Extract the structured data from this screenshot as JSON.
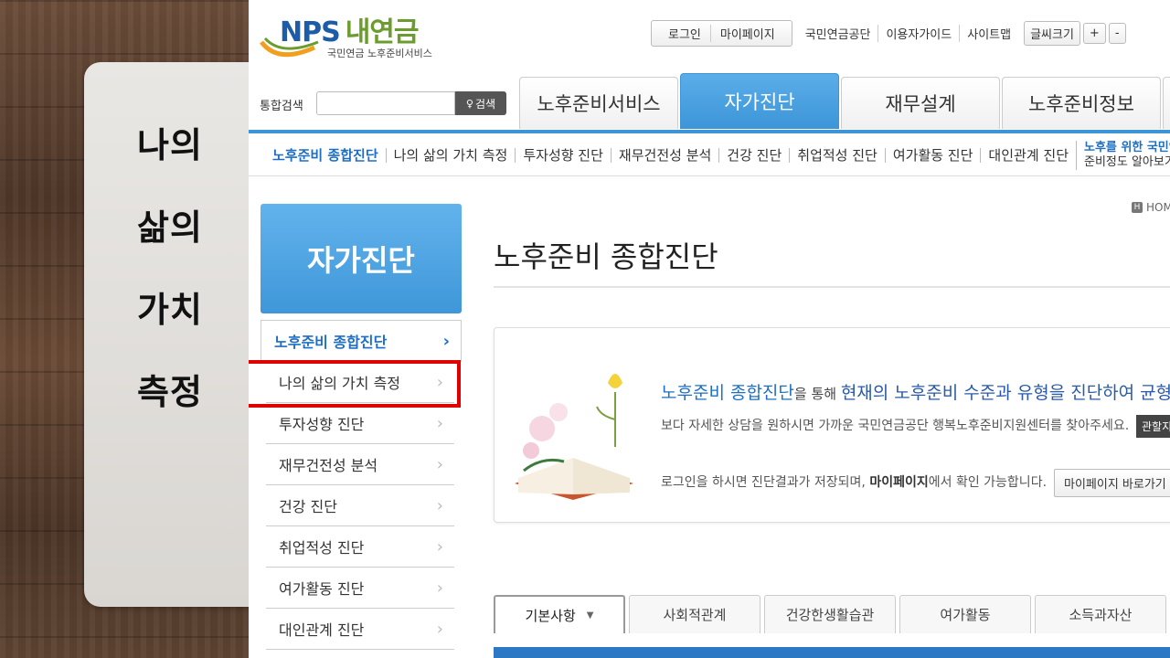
{
  "slide": {
    "title_words": [
      "나의",
      "삶의",
      "가치",
      "측정"
    ]
  },
  "header": {
    "logo_main": "NPS",
    "logo_kor": "내연금",
    "logo_sub": "국민연금 노후준비서비스",
    "util_box": [
      "로그인",
      "마이페이지"
    ],
    "util_links": [
      "국민연금공단",
      "이용자가이드",
      "사이트맵"
    ],
    "font_size_label": "글씨크기",
    "font_plus": "+",
    "font_minus": "-",
    "search_label": "통합검색",
    "search_button": "검색"
  },
  "gnb": {
    "tabs": [
      "노후준비서비스",
      "자가진단",
      "재무설계",
      "노후준비정보"
    ],
    "active": "자가진단"
  },
  "subnav": {
    "items": [
      "노후준비 종합진단",
      "나의 삶의 가치 측정",
      "투자성향 진단",
      "재무건전성 분석",
      "건강 진단",
      "취업적성 진단",
      "여가활동 진단",
      "대인관계 진단"
    ],
    "last_line1": "노후를 위한 국민연",
    "last_line2": "준비정도 알아보기"
  },
  "lnb": {
    "title": "자가진단",
    "items": [
      "노후준비 종합진단",
      "나의 삶의 가치 측정",
      "투자성향 진단",
      "재무건전성 분석",
      "건강 진단",
      "취업적성 진단",
      "여가활동 진단",
      "대인관계 진단"
    ]
  },
  "main": {
    "home": "HOM",
    "page_title": "노후준비 종합진단",
    "intro_l1_a": "노후준비 종합진단",
    "intro_l1_b": "을 통해 ",
    "intro_l1_c": "현재의 노후준비 수준과 유형을 진단하여 균형있는 노후",
    "intro_l2": "보다 자세한 상담을 원하시면 가까운 국민연금공단 행복노후준비지원센터를 찾아주세요.",
    "intro_btn_dark": "관할지",
    "intro_l3_a": "로그인을 하시면 진단결과가 저장되며, ",
    "intro_l3_b": "마이페이지",
    "intro_l3_c": "에서 확인 가능합니다.",
    "intro_btn_light": "마이페이지 바로가기",
    "tabs": [
      "기본사항",
      "사회적관계",
      "건강한생활습관",
      "여가활동",
      "소득과자산"
    ]
  },
  "colors": {
    "accent": "#3d95d8",
    "link": "#1e6fc2",
    "highlight": "#e00000"
  }
}
